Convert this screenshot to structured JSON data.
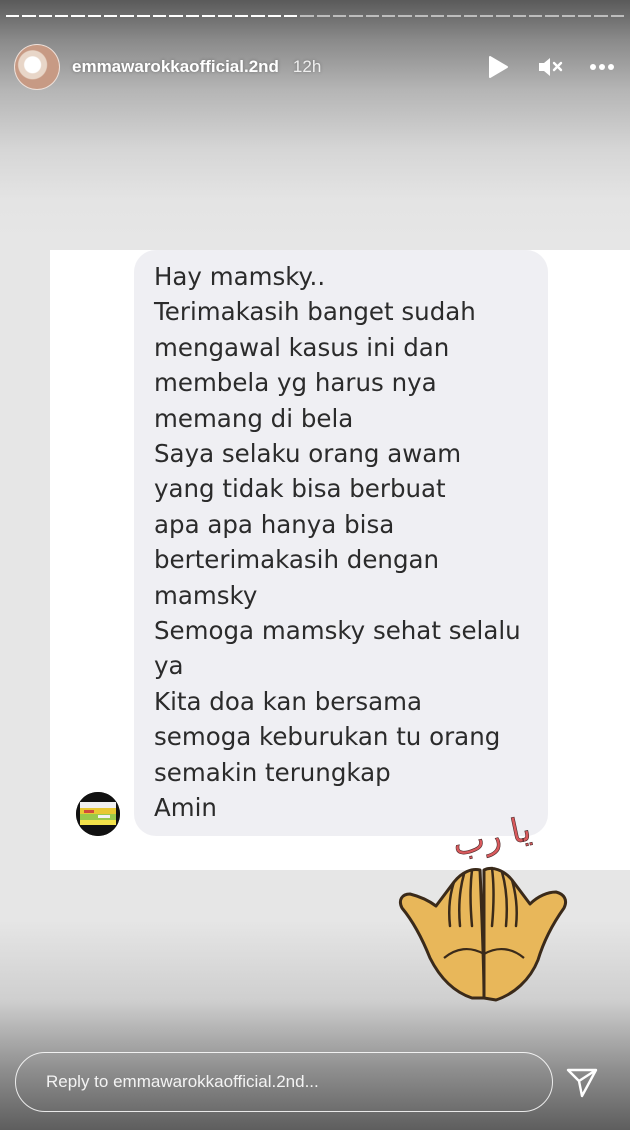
{
  "story": {
    "username": "emmawarokkaofficial.2nd",
    "time_ago": "12h",
    "progress_segments": 38,
    "progress_completed": 18
  },
  "header_icons": {
    "play": "play-icon",
    "mute": "mute-icon",
    "more": "more-icon"
  },
  "message": {
    "lines": [
      "Hay mamsky..",
      "Terimakasih banget sudah",
      "mengawal kasus ini dan",
      "membela yg harus nya",
      "memang di bela",
      "Saya selaku orang awam",
      "yang tidak bisa berbuat",
      "apa apa hanya bisa",
      "berterimakasih dengan",
      "mamsky",
      "Semoga mamsky sehat selalu",
      "ya",
      "Kita doa kan bersama",
      "semoga keburukan tu orang",
      "semakin terungkap",
      "Amin"
    ],
    "bubble_color": "#efeff3"
  },
  "sticker": {
    "arabic_text": "يا رب",
    "icon": "praying-hands-sticker"
  },
  "reply": {
    "placeholder": "Reply to emmawarokkaofficial.2nd..."
  },
  "colors": {
    "text_white": "#ffffff",
    "message_text": "#2b2b2b",
    "sticker_text": "#d9595c",
    "hands_fill": "#e8b75a"
  }
}
